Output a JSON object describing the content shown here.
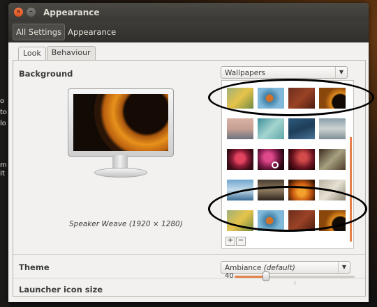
{
  "window": {
    "title": "Appearance"
  },
  "navbar": {
    "all_settings": "All Settings",
    "current": "Appearance"
  },
  "tabs": [
    {
      "label": "Look"
    },
    {
      "label": "Behaviour"
    }
  ],
  "background": {
    "label": "Background",
    "source_selected": "Wallpapers",
    "caption": "Speaker Weave (1920 × 1280)",
    "add_symbol": "+",
    "remove_symbol": "−"
  },
  "theme": {
    "label": "Theme",
    "value": "Ambiance",
    "suffix": "(default)"
  },
  "launcher": {
    "label": "Launcher icon size",
    "value": "40"
  },
  "desktop_text": [
    "o",
    "to",
    "lo",
    "m",
    "It"
  ]
}
